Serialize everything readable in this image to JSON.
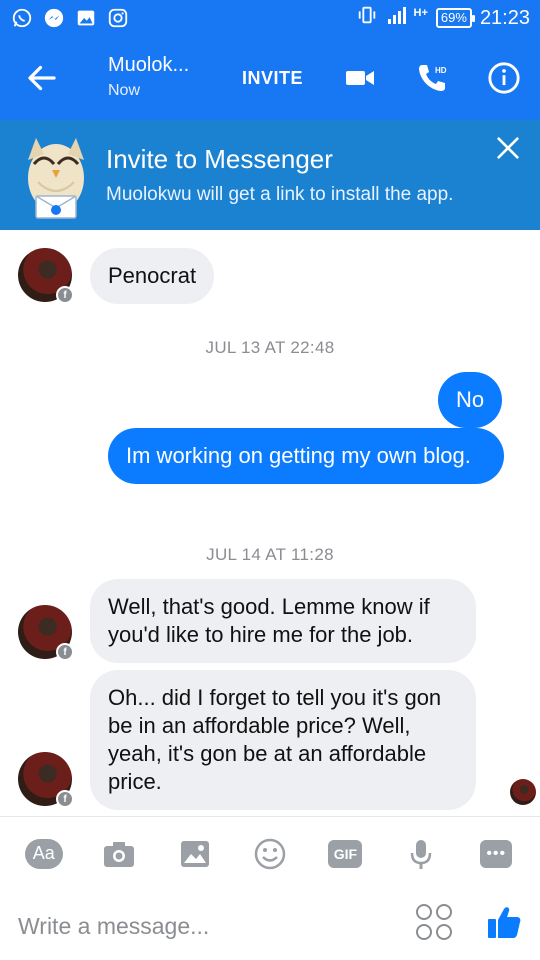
{
  "status_bar": {
    "battery": "69%",
    "time": "21:23",
    "network": "H+"
  },
  "header": {
    "title": "Muolok...",
    "subtitle": "Now",
    "invite_label": "INVITE",
    "hd_label": "HD"
  },
  "banner": {
    "title": "Invite to Messenger",
    "subtitle": "Muolokwu will get a link to install the app."
  },
  "messages": [
    {
      "from": "contact",
      "text": "Penocrat"
    },
    {
      "type": "timestamp",
      "text": "JUL 13 AT 22:48"
    },
    {
      "from": "me",
      "text": "No"
    },
    {
      "from": "me",
      "text": "Im working on getting my own blog."
    },
    {
      "type": "timestamp",
      "text": "JUL 14 AT 11:28"
    },
    {
      "from": "contact",
      "text": "Well, that's good. Lemme know if you'd like to hire me for the job."
    },
    {
      "from": "contact",
      "text": "Oh... did I forget to tell you it's gon be in an affordable price? Well, yeah, it's gon be at an affordable price."
    }
  ],
  "toolbar": {
    "aa_label": "Aa",
    "gif_label": "GIF",
    "more_label": "•••",
    "icons": [
      "text-format-icon",
      "camera-icon",
      "gallery-icon",
      "emoji-icon",
      "gif-icon",
      "microphone-icon",
      "more-icon"
    ]
  },
  "composer": {
    "placeholder": "Write a message..."
  },
  "colors": {
    "brand": "#1877f2",
    "banner": "#1b82d1",
    "outgoing_bubble": "#0b7bff",
    "incoming_bubble": "#eeeff2"
  }
}
